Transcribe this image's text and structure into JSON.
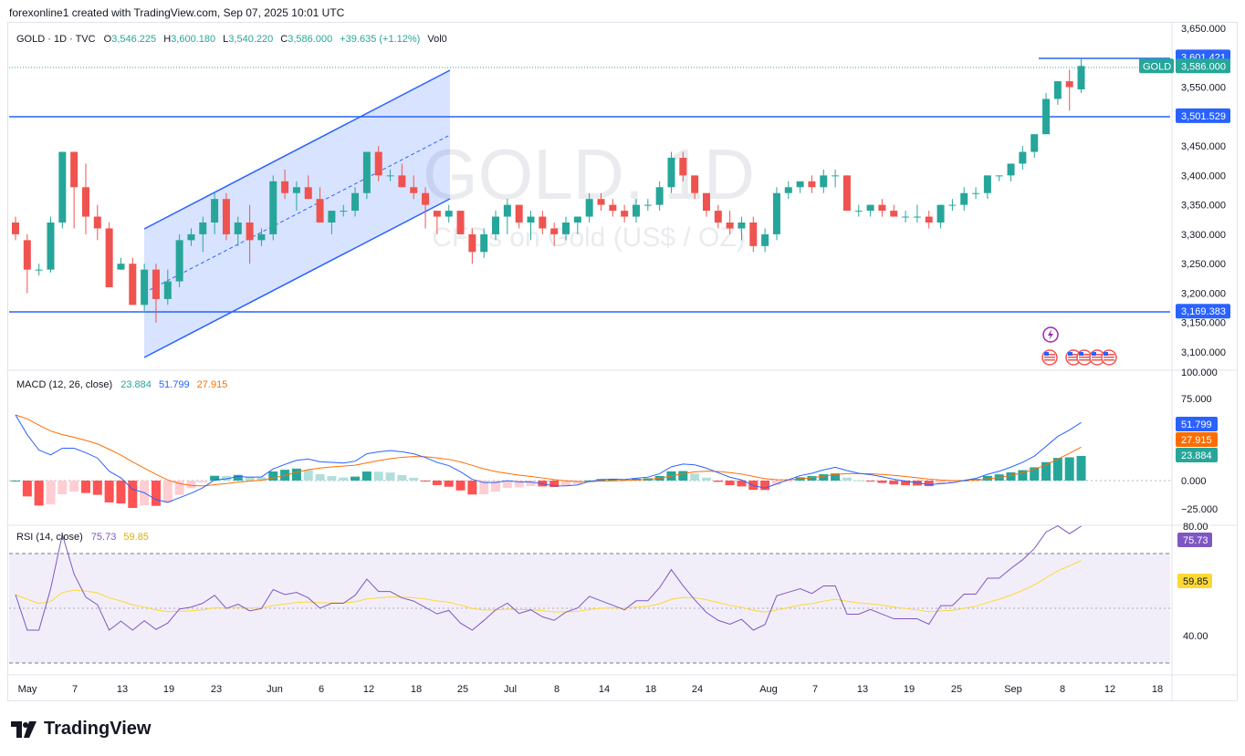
{
  "caption": "forexonline1 created with TradingView.com, Sep 07, 2025 10:01 UTC",
  "brand": "TradingView",
  "legend": {
    "symbol": "GOLD · 1D · TVC",
    "o_label": "O",
    "o": "3,546.225",
    "h_label": "H",
    "h": "3,600.180",
    "l_label": "L",
    "l": "3,540.220",
    "c_label": "C",
    "c": "3,586.000",
    "change": "+39.635 (+1.12%)",
    "vol": "Vol0"
  },
  "watermark": {
    "title": "GOLD, 1D",
    "subtitle": "CFDs on Gold (US$ / OZ)"
  },
  "colors": {
    "up": "#26a69a",
    "down": "#ef5350",
    "line": "#2962ff",
    "channel_fill": "#2962ff",
    "macd": "#2962ff",
    "signal": "#ff6d00",
    "rsi": "#7e57c2",
    "rsi_ma": "#fdd835",
    "hist_up_strong": "#26a69a",
    "hist_up_weak": "#b2dfdb",
    "hist_dn_strong": "#ff5252",
    "hist_dn_weak": "#ffcdd2"
  },
  "price_axis": [
    "3,650.000",
    "3,550.000",
    "3,450.000",
    "3,400.000",
    "3,350.000",
    "3,300.000",
    "3,250.000",
    "3,200.000",
    "3,150.000",
    "3,100.000"
  ],
  "price_labels": [
    {
      "text": "3,601.421",
      "kind": "line"
    },
    {
      "text": "3,586.000",
      "kind": "last",
      "tag": "GOLD"
    },
    {
      "text": "3,501.529",
      "kind": "line"
    },
    {
      "text": "3,169.383",
      "kind": "line"
    }
  ],
  "macd": {
    "title": "MACD (12, 26, close)",
    "v1": "23.884",
    "v2": "51.799",
    "v3": "27.915",
    "axis": [
      "100.000",
      "75.000",
      "25.000",
      "0.000",
      "−25.000"
    ],
    "labels": [
      "51.799",
      "27.915",
      "23.884"
    ]
  },
  "rsi": {
    "title": "RSI (14, close)",
    "v1": "75.73",
    "v2": "59.85",
    "axis": [
      "80.00",
      "40.00"
    ],
    "labels": [
      "75.73",
      "59.85"
    ]
  },
  "time_axis": [
    "May",
    "7",
    "13",
    "19",
    "23",
    "Jun",
    "6",
    "12",
    "18",
    "25",
    "Jul",
    "8",
    "14",
    "18",
    "24",
    "Aug",
    "7",
    "13",
    "19",
    "25",
    "Sep",
    "8",
    "12",
    "18"
  ],
  "chart_data": {
    "type": "candlestick",
    "title": "GOLD, 1D",
    "ylim": [
      3080,
      3660
    ],
    "horizontal_levels": [
      3601.421,
      3501.529,
      3169.383
    ],
    "candles": [
      [
        3320,
        3330,
        3290,
        3300
      ],
      [
        3290,
        3300,
        3200,
        3240
      ],
      [
        3240,
        3250,
        3230,
        3240
      ],
      [
        3240,
        3330,
        3235,
        3320
      ],
      [
        3320,
        3440,
        3310,
        3440
      ],
      [
        3440,
        3440,
        3310,
        3380
      ],
      [
        3380,
        3420,
        3300,
        3330
      ],
      [
        3330,
        3350,
        3290,
        3310
      ],
      [
        3310,
        3320,
        3210,
        3210
      ],
      [
        3240,
        3260,
        3240,
        3250
      ],
      [
        3250,
        3260,
        3180,
        3180
      ],
      [
        3180,
        3250,
        3170,
        3240
      ],
      [
        3240,
        3250,
        3150,
        3190
      ],
      [
        3190,
        3240,
        3180,
        3220
      ],
      [
        3220,
        3300,
        3210,
        3290
      ],
      [
        3290,
        3310,
        3280,
        3300
      ],
      [
        3300,
        3330,
        3270,
        3320
      ],
      [
        3320,
        3370,
        3300,
        3360
      ],
      [
        3360,
        3370,
        3290,
        3300
      ],
      [
        3300,
        3330,
        3280,
        3320
      ],
      [
        3320,
        3350,
        3250,
        3290
      ],
      [
        3290,
        3310,
        3280,
        3300
      ],
      [
        3300,
        3400,
        3290,
        3390
      ],
      [
        3390,
        3410,
        3360,
        3370
      ],
      [
        3370,
        3390,
        3340,
        3380
      ],
      [
        3380,
        3400,
        3360,
        3360
      ],
      [
        3360,
        3380,
        3320,
        3320
      ],
      [
        3320,
        3340,
        3300,
        3340
      ],
      [
        3340,
        3350,
        3330,
        3340
      ],
      [
        3340,
        3380,
        3330,
        3370
      ],
      [
        3370,
        3440,
        3360,
        3440
      ],
      [
        3440,
        3450,
        3390,
        3400
      ],
      [
        3400,
        3410,
        3390,
        3400
      ],
      [
        3400,
        3420,
        3380,
        3380
      ],
      [
        3380,
        3400,
        3360,
        3370
      ],
      [
        3370,
        3380,
        3310,
        3350
      ],
      [
        3340,
        3340,
        3300,
        3330
      ],
      [
        3330,
        3350,
        3320,
        3340
      ],
      [
        3340,
        3340,
        3300,
        3300
      ],
      [
        3300,
        3310,
        3250,
        3270
      ],
      [
        3270,
        3310,
        3260,
        3300
      ],
      [
        3300,
        3340,
        3290,
        3330
      ],
      [
        3330,
        3360,
        3300,
        3350
      ],
      [
        3350,
        3340,
        3310,
        3320
      ],
      [
        3320,
        3340,
        3290,
        3330
      ],
      [
        3330,
        3340,
        3300,
        3310
      ],
      [
        3310,
        3320,
        3280,
        3300
      ],
      [
        3300,
        3330,
        3290,
        3320
      ],
      [
        3320,
        3330,
        3300,
        3330
      ],
      [
        3330,
        3370,
        3320,
        3360
      ],
      [
        3360,
        3370,
        3340,
        3350
      ],
      [
        3350,
        3360,
        3330,
        3340
      ],
      [
        3340,
        3350,
        3320,
        3330
      ],
      [
        3330,
        3360,
        3320,
        3350
      ],
      [
        3350,
        3360,
        3340,
        3350
      ],
      [
        3350,
        3390,
        3340,
        3380
      ],
      [
        3380,
        3440,
        3370,
        3430
      ],
      [
        3430,
        3440,
        3390,
        3400
      ],
      [
        3400,
        3400,
        3360,
        3370
      ],
      [
        3370,
        3370,
        3330,
        3340
      ],
      [
        3340,
        3350,
        3310,
        3320
      ],
      [
        3320,
        3340,
        3300,
        3310
      ],
      [
        3310,
        3330,
        3290,
        3320
      ],
      [
        3320,
        3330,
        3270,
        3280
      ],
      [
        3280,
        3310,
        3270,
        3300
      ],
      [
        3300,
        3380,
        3290,
        3370
      ],
      [
        3370,
        3390,
        3360,
        3380
      ],
      [
        3380,
        3390,
        3370,
        3390
      ],
      [
        3390,
        3400,
        3370,
        3380
      ],
      [
        3380,
        3410,
        3370,
        3400
      ],
      [
        3400,
        3410,
        3380,
        3400
      ],
      [
        3400,
        3400,
        3360,
        3340
      ],
      [
        3340,
        3350,
        3330,
        3340
      ],
      [
        3340,
        3350,
        3330,
        3350
      ],
      [
        3350,
        3360,
        3330,
        3340
      ],
      [
        3340,
        3350,
        3330,
        3330
      ],
      [
        3330,
        3340,
        3320,
        3330
      ],
      [
        3330,
        3350,
        3320,
        3330
      ],
      [
        3330,
        3340,
        3310,
        3320
      ],
      [
        3320,
        3350,
        3310,
        3350
      ],
      [
        3350,
        3360,
        3340,
        3350
      ],
      [
        3350,
        3380,
        3340,
        3370
      ],
      [
        3370,
        3380,
        3360,
        3370
      ],
      [
        3370,
        3400,
        3360,
        3400
      ],
      [
        3400,
        3400,
        3390,
        3400
      ],
      [
        3400,
        3420,
        3390,
        3420
      ],
      [
        3420,
        3450,
        3410,
        3440
      ],
      [
        3440,
        3470,
        3430,
        3470
      ],
      [
        3470,
        3540,
        3470,
        3530
      ],
      [
        3530,
        3560,
        3520,
        3560
      ],
      [
        3560,
        3580,
        3510,
        3550
      ],
      [
        3546.225,
        3600.18,
        3540.22,
        3586
      ]
    ]
  }
}
